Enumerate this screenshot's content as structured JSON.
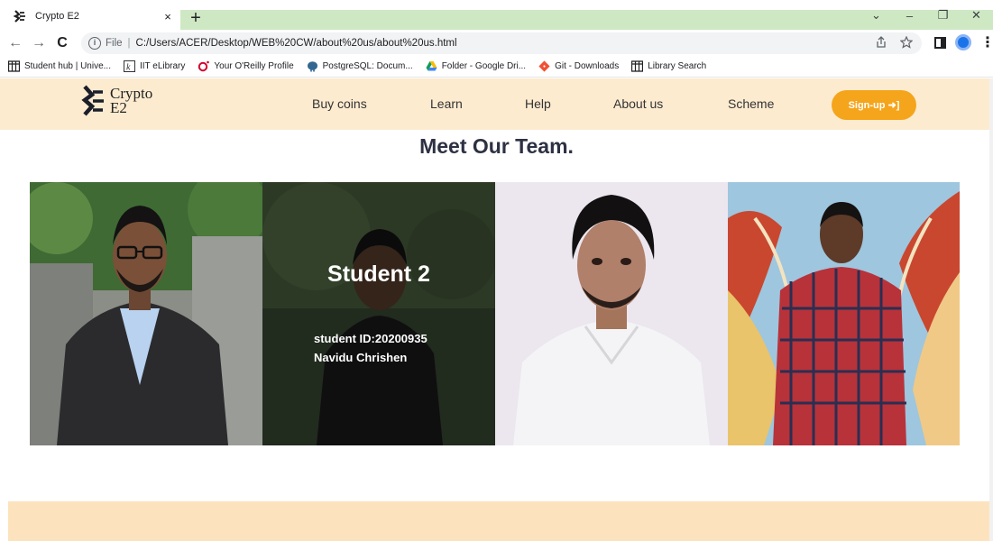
{
  "browser": {
    "tab": {
      "title": "Crypto E2",
      "close": "×"
    },
    "new_tab": "+",
    "window_controls": {
      "minimize": "–",
      "restore": "❐",
      "close": "✕",
      "dropdown": "⌄"
    },
    "nav": {
      "back": "←",
      "forward": "→",
      "reload": "C"
    },
    "address": {
      "info": "i",
      "scheme_label": "File",
      "separator": "|",
      "url": "C:/Users/ACER/Desktop/WEB%20CW/about%20us/about%20us.html"
    },
    "bookmarks": [
      {
        "label": "Student hub | Unive...",
        "icon": "grid-icon"
      },
      {
        "label": "IIT eLibrary",
        "icon": "k-icon"
      },
      {
        "label": "Your O'Reilly Profile",
        "icon": "oreilly-icon"
      },
      {
        "label": "PostgreSQL: Docum...",
        "icon": "elephant-icon"
      },
      {
        "label": "Folder - Google Dri...",
        "icon": "drive-icon"
      },
      {
        "label": "Git - Downloads",
        "icon": "git-icon"
      },
      {
        "label": "Library Search",
        "icon": "grid-icon"
      }
    ]
  },
  "site": {
    "logo": {
      "line1": "Crypto",
      "line2": "E2"
    },
    "nav": [
      {
        "label": "Buy coins"
      },
      {
        "label": "Learn"
      },
      {
        "label": "Help"
      },
      {
        "label": "About us"
      },
      {
        "label": "Scheme"
      }
    ],
    "signup": {
      "label": "Sign-up ➜]"
    },
    "team_title": "Meet Our Team.",
    "team": [
      {
        "portrait": "person-glasses-suit"
      },
      {
        "portrait": "person-dark-shirt",
        "name": "Student 2",
        "id_line": "student ID:20200935",
        "full_name": "Navidu Chrishen"
      },
      {
        "portrait": "person-white-shirt"
      },
      {
        "portrait": "person-red-check-shirt-wings"
      }
    ]
  },
  "colors": {
    "navbar_bg": "#fdebd0",
    "accent": "#f5a51b",
    "title": "#2d3142",
    "footer_bg": "#fde3bd",
    "tabstrip_green": "#cfe8c4"
  }
}
